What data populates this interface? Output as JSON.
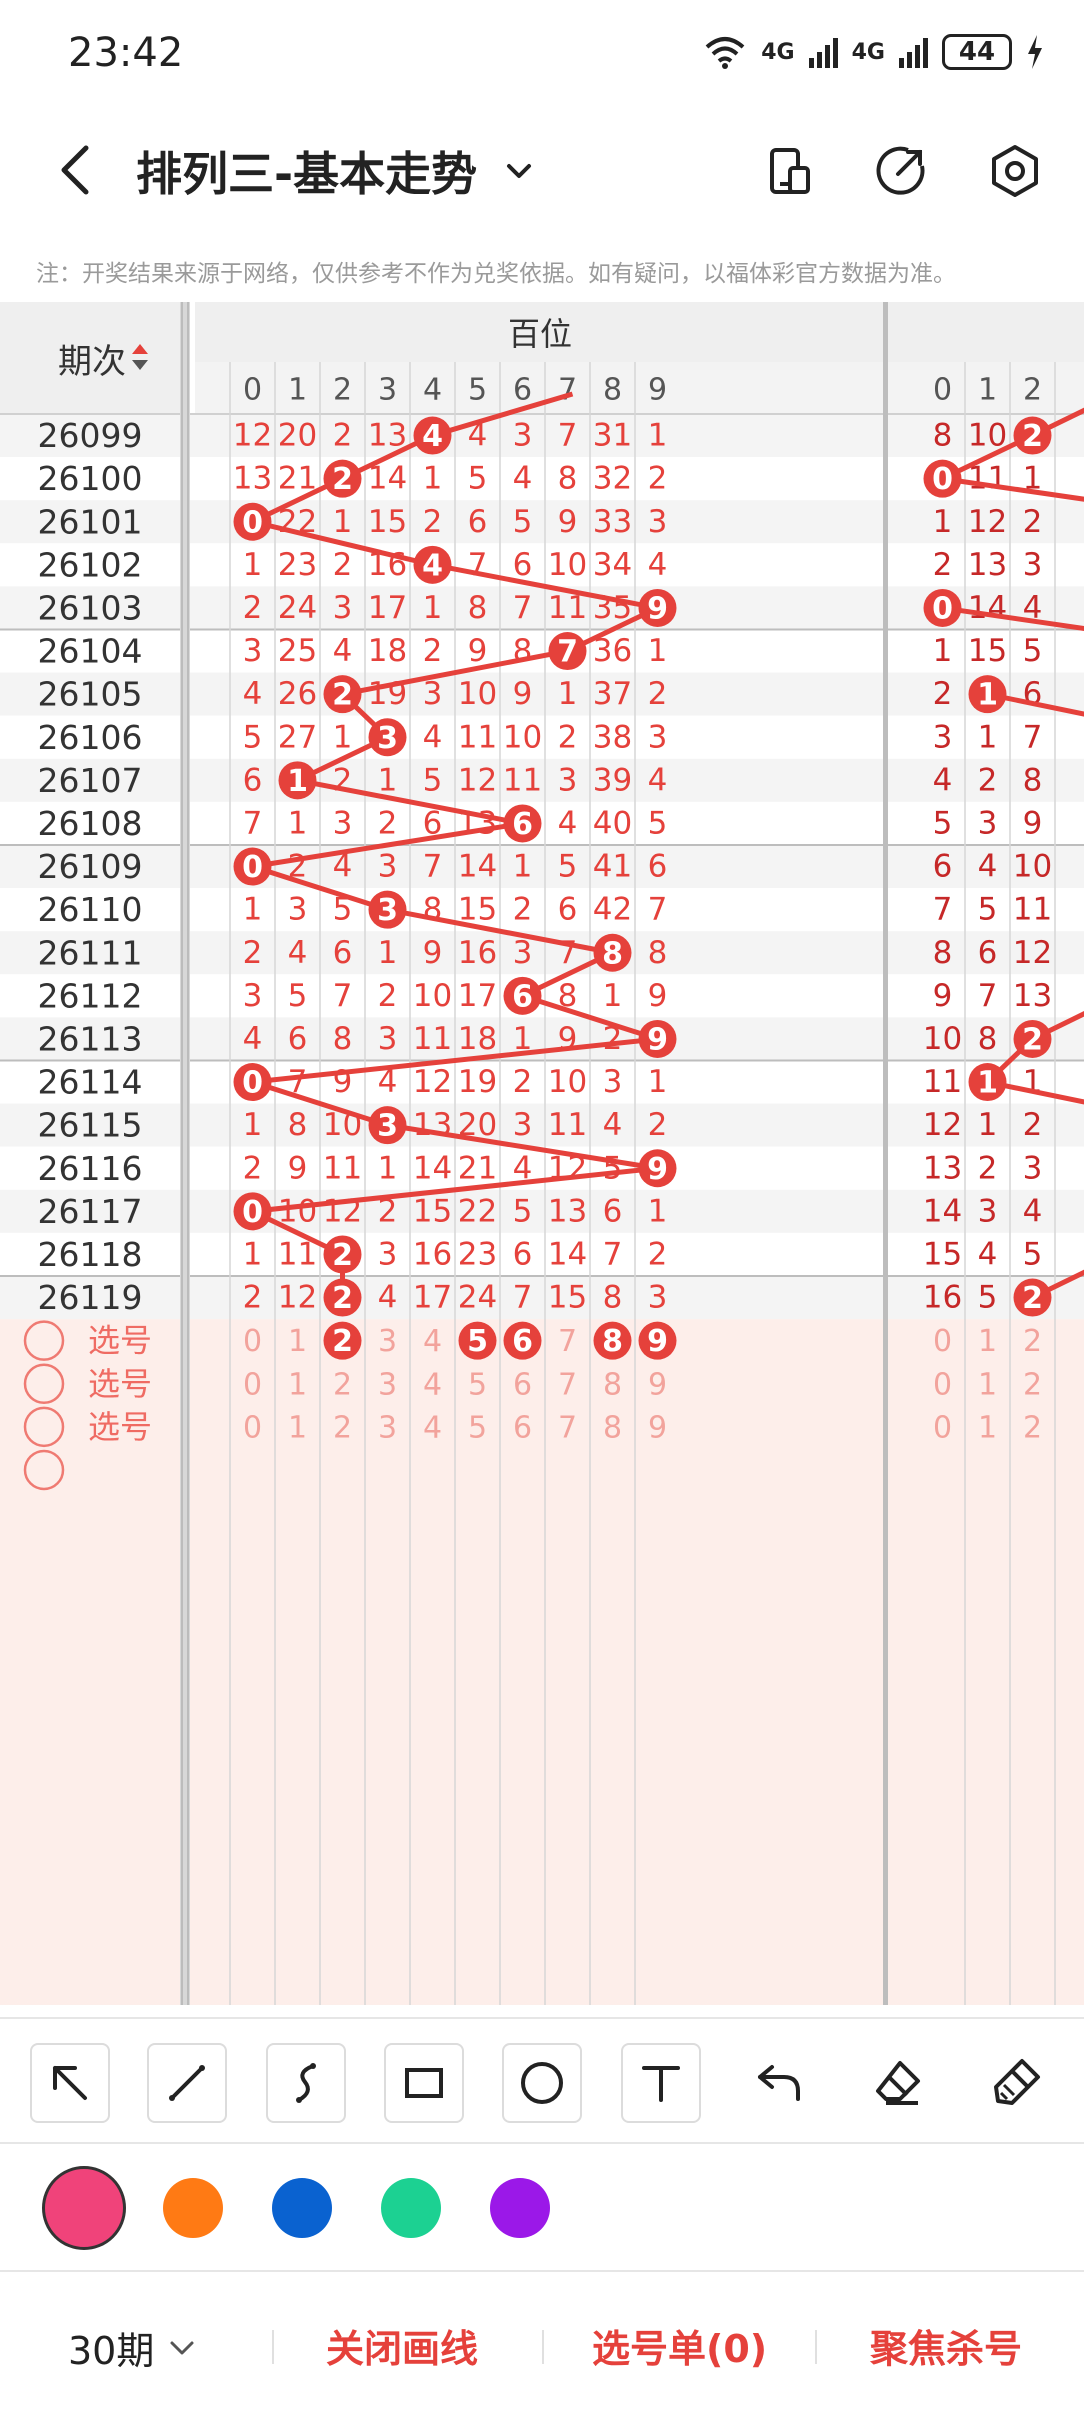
{
  "status_bar": {
    "time": "23:42",
    "network_1": "4G",
    "network_2": "4G",
    "battery": "44"
  },
  "header": {
    "title": "排列三-基本走势",
    "icons": [
      "back-icon",
      "chevron-down-icon",
      "phone-layout-icon",
      "share-arrow-icon",
      "settings-hexagon-icon"
    ]
  },
  "notice": "注：开奖结果来源于网络，仅供参考不作为兑奖依据。如有疑问，以福体彩官方数据为准。",
  "table": {
    "period_header": "期次",
    "group_header": "百位",
    "columns_a": [
      "0",
      "1",
      "2",
      "3",
      "4",
      "5",
      "6",
      "7",
      "8",
      "9"
    ],
    "columns_b": [
      "0",
      "1",
      "2"
    ],
    "rows": [
      {
        "period": "26099",
        "a": [
          "12",
          "20",
          "2",
          "13",
          "4",
          "4",
          "3",
          "7",
          "31",
          "1"
        ],
        "b": [
          "8",
          "10",
          "2"
        ],
        "hit_a": 4,
        "hit_b": 2
      },
      {
        "period": "26100",
        "a": [
          "13",
          "21",
          "2",
          "14",
          "1",
          "5",
          "4",
          "8",
          "32",
          "2"
        ],
        "b": [
          "0",
          "11",
          "1"
        ],
        "hit_a": 2,
        "hit_b": 0
      },
      {
        "period": "26101",
        "a": [
          "0",
          "22",
          "1",
          "15",
          "2",
          "6",
          "5",
          "9",
          "33",
          "3"
        ],
        "b": [
          "1",
          "12",
          "2"
        ],
        "hit_a": 0,
        "hit_b": null
      },
      {
        "period": "26102",
        "a": [
          "1",
          "23",
          "2",
          "16",
          "4",
          "7",
          "6",
          "10",
          "34",
          "4"
        ],
        "b": [
          "2",
          "13",
          "3"
        ],
        "hit_a": 4,
        "hit_b": null
      },
      {
        "period": "26103",
        "a": [
          "2",
          "24",
          "3",
          "17",
          "1",
          "8",
          "7",
          "11",
          "35",
          "9"
        ],
        "b": [
          "0",
          "14",
          "4"
        ],
        "hit_a": 9,
        "hit_b": 0
      },
      {
        "period": "26104",
        "a": [
          "3",
          "25",
          "4",
          "18",
          "2",
          "9",
          "8",
          "7",
          "36",
          "1"
        ],
        "b": [
          "1",
          "15",
          "5"
        ],
        "hit_a": 7,
        "hit_b": null
      },
      {
        "period": "26105",
        "a": [
          "4",
          "26",
          "2",
          "19",
          "3",
          "10",
          "9",
          "1",
          "37",
          "2"
        ],
        "b": [
          "2",
          "1",
          "6"
        ],
        "hit_a": 2,
        "hit_b": 1
      },
      {
        "period": "26106",
        "a": [
          "5",
          "27",
          "1",
          "3",
          "4",
          "11",
          "10",
          "2",
          "38",
          "3"
        ],
        "b": [
          "3",
          "1",
          "7"
        ],
        "hit_a": 3,
        "hit_b": null
      },
      {
        "period": "26107",
        "a": [
          "6",
          "1",
          "2",
          "1",
          "5",
          "12",
          "11",
          "3",
          "39",
          "4"
        ],
        "b": [
          "4",
          "2",
          "8"
        ],
        "hit_a": 1,
        "hit_b": null
      },
      {
        "period": "26108",
        "a": [
          "7",
          "1",
          "3",
          "2",
          "6",
          "13",
          "6",
          "4",
          "40",
          "5"
        ],
        "b": [
          "5",
          "3",
          "9"
        ],
        "hit_a": 6,
        "hit_b": null
      },
      {
        "period": "26109",
        "a": [
          "0",
          "2",
          "4",
          "3",
          "7",
          "14",
          "1",
          "5",
          "41",
          "6"
        ],
        "b": [
          "6",
          "4",
          "10"
        ],
        "hit_a": 0,
        "hit_b": null
      },
      {
        "period": "26110",
        "a": [
          "1",
          "3",
          "5",
          "3",
          "8",
          "15",
          "2",
          "6",
          "42",
          "7"
        ],
        "b": [
          "7",
          "5",
          "11"
        ],
        "hit_a": 3,
        "hit_b": null
      },
      {
        "period": "26111",
        "a": [
          "2",
          "4",
          "6",
          "1",
          "9",
          "16",
          "3",
          "7",
          "8",
          "8"
        ],
        "b": [
          "8",
          "6",
          "12"
        ],
        "hit_a": 8,
        "hit_b": null
      },
      {
        "period": "26112",
        "a": [
          "3",
          "5",
          "7",
          "2",
          "10",
          "17",
          "6",
          "8",
          "1",
          "9"
        ],
        "b": [
          "9",
          "7",
          "13"
        ],
        "hit_a": 6,
        "hit_b": null
      },
      {
        "period": "26113",
        "a": [
          "4",
          "6",
          "8",
          "3",
          "11",
          "18",
          "1",
          "9",
          "2",
          "9"
        ],
        "b": [
          "10",
          "8",
          "2"
        ],
        "hit_a": 9,
        "hit_b": 2
      },
      {
        "period": "26114",
        "a": [
          "0",
          "7",
          "9",
          "4",
          "12",
          "19",
          "2",
          "10",
          "3",
          "1"
        ],
        "b": [
          "11",
          "1",
          "1"
        ],
        "hit_a": 0,
        "hit_b": 1
      },
      {
        "period": "26115",
        "a": [
          "1",
          "8",
          "10",
          "3",
          "13",
          "20",
          "3",
          "11",
          "4",
          "2"
        ],
        "b": [
          "12",
          "1",
          "2"
        ],
        "hit_a": 3,
        "hit_b": null
      },
      {
        "period": "26116",
        "a": [
          "2",
          "9",
          "11",
          "1",
          "14",
          "21",
          "4",
          "12",
          "5",
          "9"
        ],
        "b": [
          "13",
          "2",
          "3"
        ],
        "hit_a": 9,
        "hit_b": null
      },
      {
        "period": "26117",
        "a": [
          "0",
          "10",
          "12",
          "2",
          "15",
          "22",
          "5",
          "13",
          "6",
          "1"
        ],
        "b": [
          "14",
          "3",
          "4"
        ],
        "hit_a": 0,
        "hit_b": null
      },
      {
        "period": "26118",
        "a": [
          "1",
          "11",
          "2",
          "3",
          "16",
          "23",
          "6",
          "14",
          "7",
          "2"
        ],
        "b": [
          "15",
          "4",
          "5"
        ],
        "hit_a": 2,
        "hit_b": null
      },
      {
        "period": "26119",
        "a": [
          "2",
          "12",
          "2",
          "4",
          "17",
          "24",
          "7",
          "15",
          "8",
          "3"
        ],
        "b": [
          "16",
          "5",
          "2"
        ],
        "hit_a": 2,
        "hit_b": 2
      }
    ],
    "pick_label": "选号",
    "pick_rows": [
      {
        "selected_a": [
          2,
          5,
          6,
          8,
          9
        ]
      },
      {
        "selected_a": []
      },
      {
        "selected_a": []
      }
    ]
  },
  "draw_tools": [
    "pointer-arrow-icon",
    "line-icon",
    "curve-icon",
    "rectangle-icon",
    "circle-icon",
    "text-icon",
    "undo-icon",
    "eraser-icon",
    "clear-brush-icon"
  ],
  "colors": [
    "#f0437a",
    "#ff7a14",
    "#0a62d0",
    "#1cd192",
    "#9b18e8"
  ],
  "footer": {
    "period_select": "30期",
    "close_lines": "关闭画线",
    "pick_list": "选号单(0)",
    "focus_kill": "聚焦杀号"
  }
}
